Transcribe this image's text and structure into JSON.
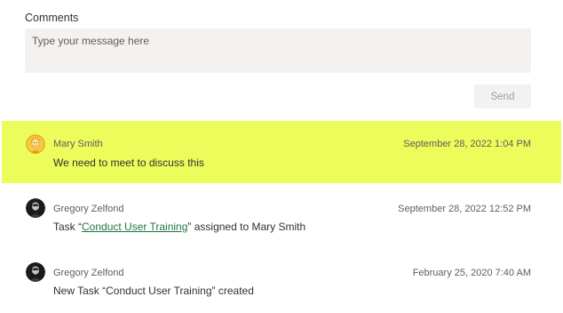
{
  "comments_section": {
    "title": "Comments",
    "input_placeholder": "Type your message here",
    "input_value": "",
    "send_label": "Send"
  },
  "entries": [
    {
      "author": "Mary Smith",
      "timestamp": "September 28, 2022 1:04 PM",
      "message": "We need to meet to discuss this",
      "highlighted": true,
      "avatar": "yellow-person-avatar"
    },
    {
      "author": "Gregory Zelfond",
      "timestamp": "September 28, 2022 12:52 PM",
      "message_prefix": "Task “",
      "message_link": "Conduct User Training",
      "message_suffix": "” assigned to Mary Smith",
      "highlighted": false,
      "avatar": "photo-avatar"
    },
    {
      "author": "Gregory Zelfond",
      "timestamp": "February 25, 2020 7:40 AM",
      "message": "New Task “Conduct User Training” created",
      "highlighted": false,
      "avatar": "photo-avatar"
    }
  ],
  "colors": {
    "highlight": "#ebfc5b",
    "link": "#217346",
    "input_bg": "#f3f2f1"
  }
}
